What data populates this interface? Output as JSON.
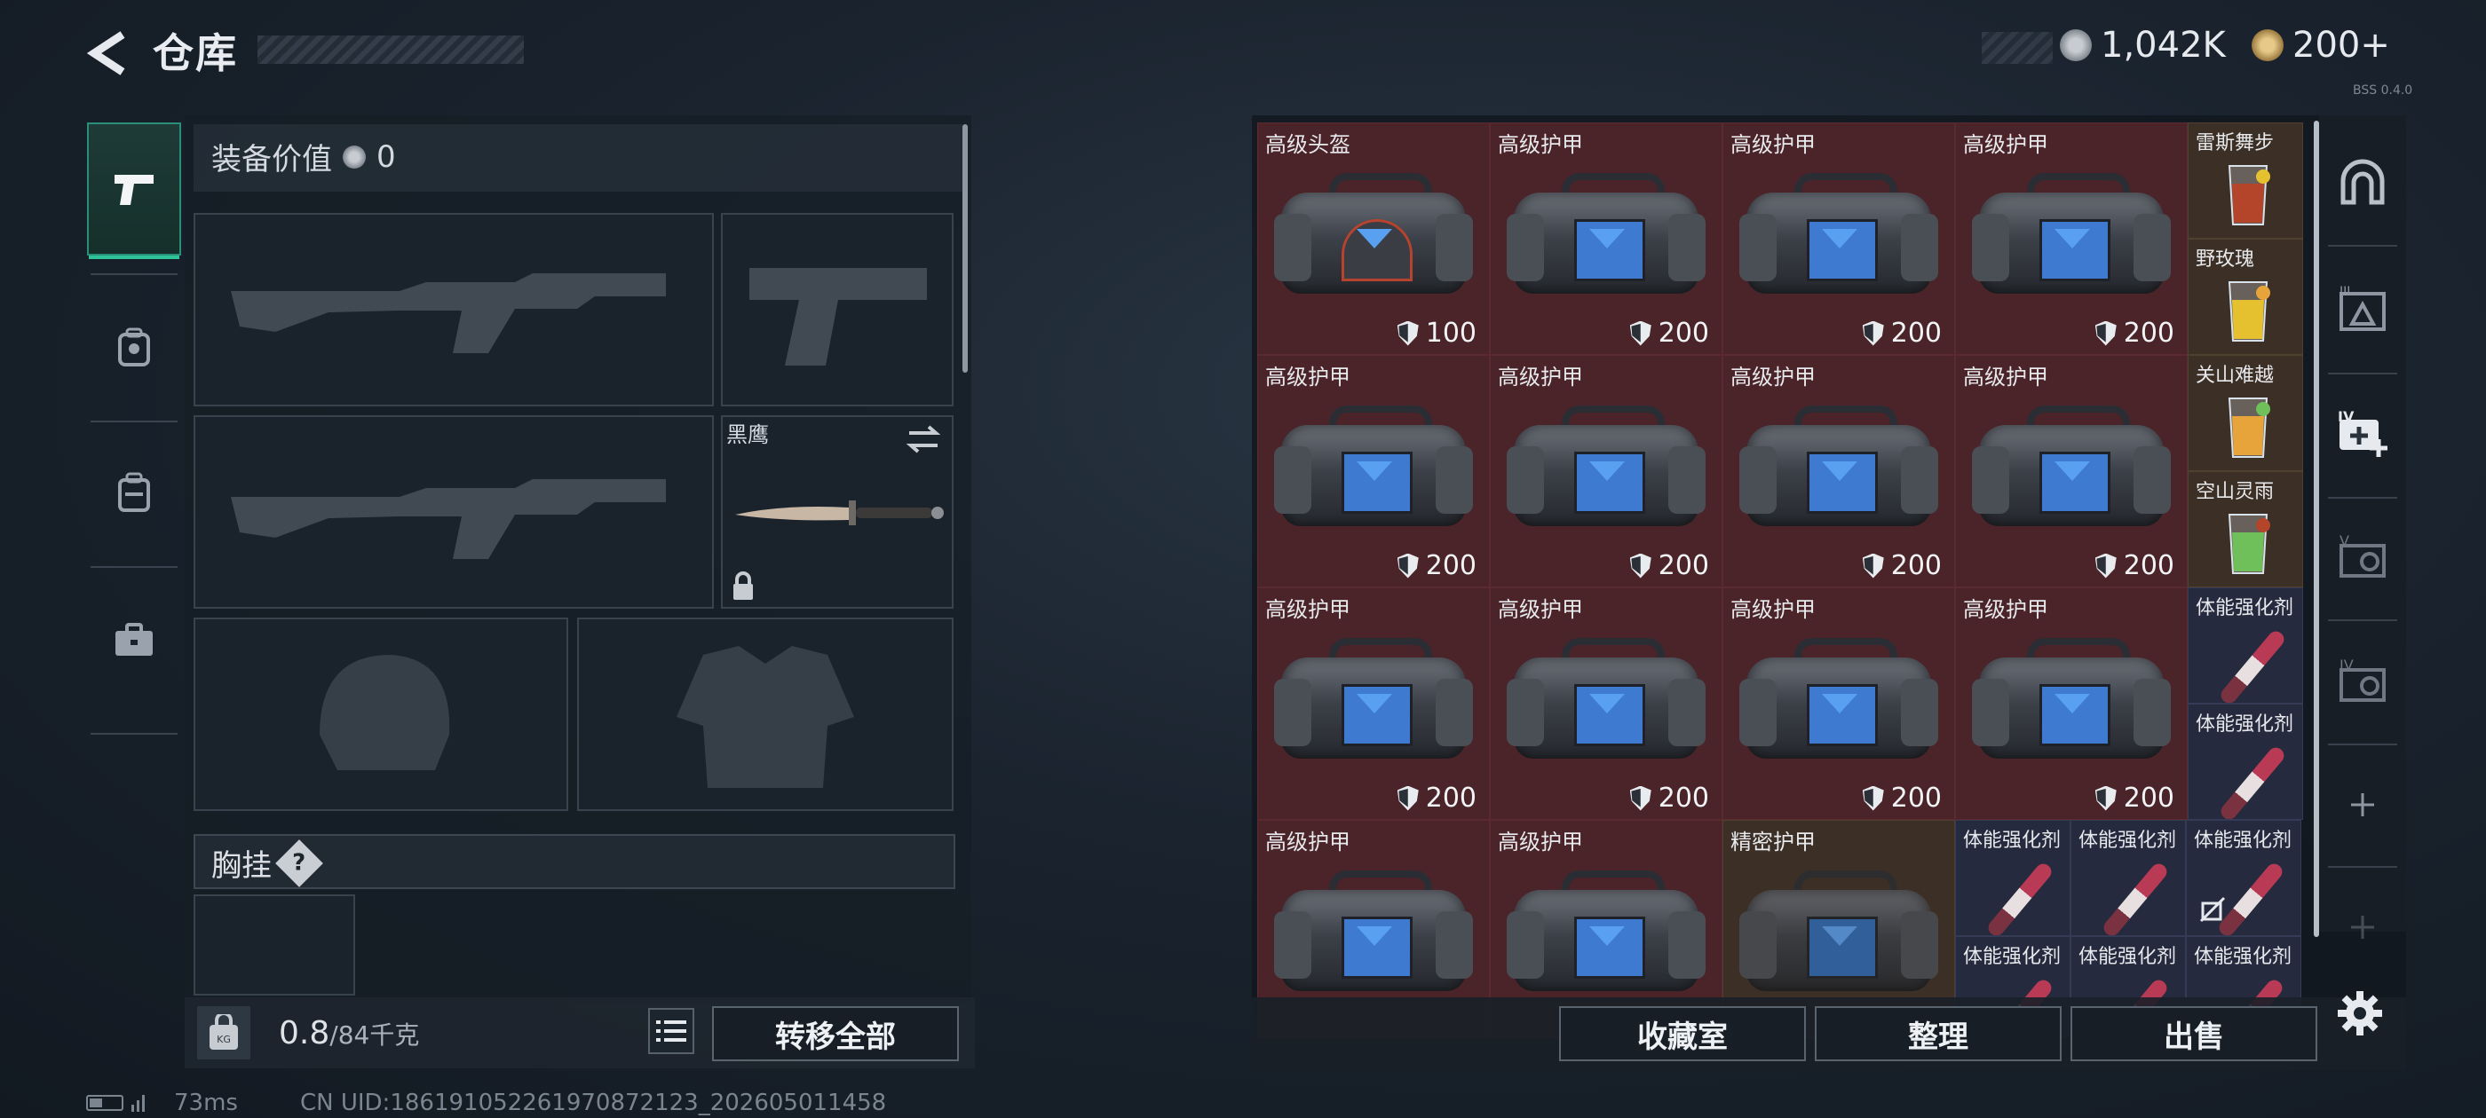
{
  "header": {
    "title": "仓库",
    "currency_silver": "1,042K",
    "currency_gold": "200+",
    "version": "BSS 0.4.0"
  },
  "equipment": {
    "value_label": "装备价值",
    "value": "0",
    "melee_name": "黑鹰",
    "chest_label": "胸挂",
    "chest_help": "?"
  },
  "left_tabs": [
    "pistol-icon",
    "backpack-icon",
    "backpack-small-icon",
    "briefcase-icon"
  ],
  "bottom_left": {
    "weight_value": "0.8",
    "weight_cap": "/84千克",
    "transfer_all": "转移全部"
  },
  "bottom_right": {
    "collection": "收藏室",
    "sort": "整理",
    "sell": "出售"
  },
  "status": {
    "ping": "73ms",
    "uid": "CN UID:18619105226197087212​3_202605011458"
  },
  "inventory": {
    "armor": [
      {
        "name": "高级头盔",
        "value": "100",
        "kind": "helmet"
      },
      {
        "name": "高级护甲",
        "value": "200",
        "kind": "armor"
      },
      {
        "name": "高级护甲",
        "value": "200",
        "kind": "armor"
      },
      {
        "name": "高级护甲",
        "value": "200",
        "kind": "armor"
      },
      {
        "name": "高级护甲",
        "value": "200",
        "kind": "armor"
      },
      {
        "name": "高级护甲",
        "value": "200",
        "kind": "armor"
      },
      {
        "name": "高级护甲",
        "value": "200",
        "kind": "armor"
      },
      {
        "name": "高级护甲",
        "value": "200",
        "kind": "armor"
      },
      {
        "name": "高级护甲",
        "value": "200",
        "kind": "armor"
      },
      {
        "name": "高级护甲",
        "value": "200",
        "kind": "armor"
      },
      {
        "name": "高级护甲",
        "value": "200",
        "kind": "armor"
      },
      {
        "name": "高级护甲",
        "value": "200",
        "kind": "armor"
      },
      {
        "name": "高级护甲",
        "value": "",
        "kind": "armor"
      },
      {
        "name": "高级护甲",
        "value": "",
        "kind": "armor"
      },
      {
        "name": "精密护甲",
        "value": "",
        "kind": "precise"
      }
    ],
    "drinks": [
      "雷斯舞步",
      "野玫瑰",
      "关山难越",
      "空山灵雨"
    ],
    "stims_column": [
      "体能强化剂",
      "体能强化剂"
    ],
    "stims_row1": [
      "体能强化剂",
      "体能强化剂",
      "体能强化剂"
    ],
    "stims_row2": [
      "体能强化剂",
      "体能强化剂",
      "体能强化剂"
    ]
  },
  "colors": {
    "armor_cell": "#4a2429",
    "drink_cell": "#3c3026",
    "stim_cell": "#262a3e",
    "accent": "#2fc39a"
  }
}
